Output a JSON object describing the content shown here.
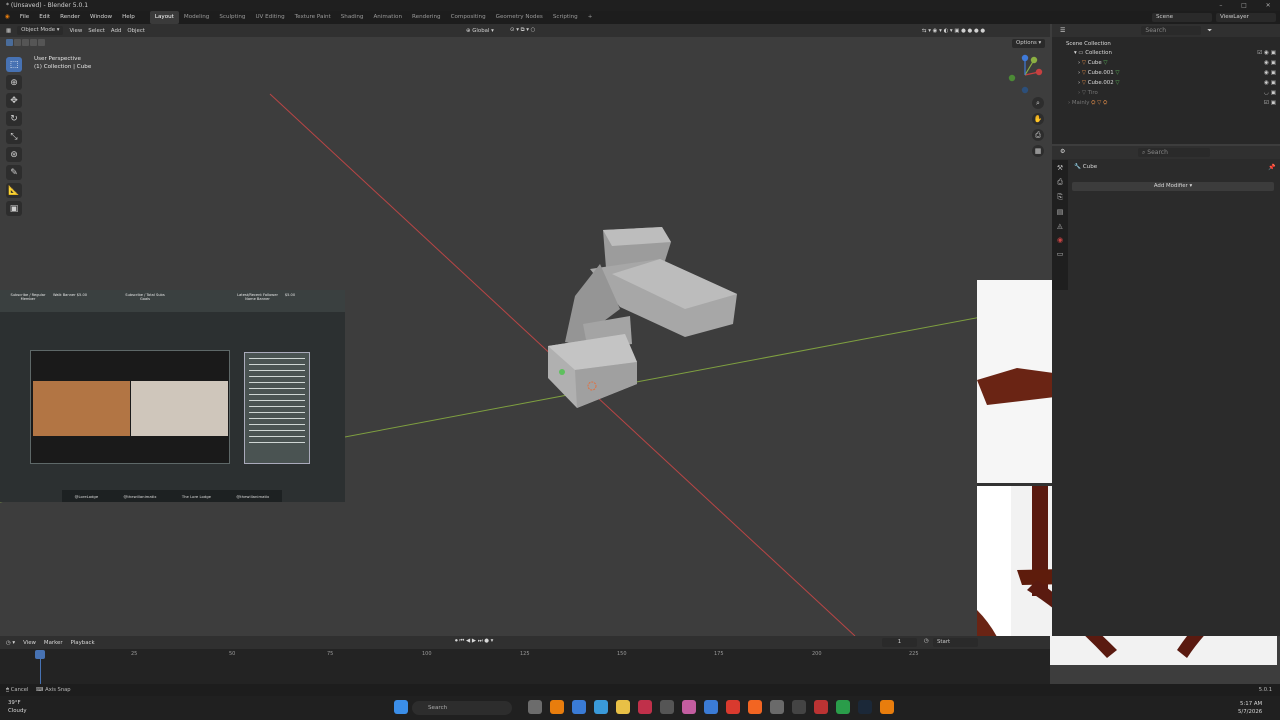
{
  "window": {
    "title": "* (Unsaved) - Blender 5.0.1"
  },
  "menu": {
    "items": [
      "File",
      "Edit",
      "Render",
      "Window",
      "Help"
    ],
    "workspaces": [
      "Layout",
      "Modeling",
      "Sculpting",
      "UV Editing",
      "Texture Paint",
      "Shading",
      "Animation",
      "Rendering",
      "Compositing",
      "Geometry Nodes",
      "Scripting"
    ],
    "active_workspace": "Layout",
    "add_tab": "+",
    "scene": "Scene",
    "view_layer": "ViewLayer"
  },
  "viewport": {
    "mode": "Object Mode",
    "menus": [
      "View",
      "Select",
      "Add",
      "Object"
    ],
    "orientation": "Global",
    "options": "Options",
    "info_line1": "User Perspective",
    "info_line2": "(1) Collection | Cube"
  },
  "outliner": {
    "search_placeholder": "Search",
    "scene_collection": "Scene Collection",
    "collection": "Collection",
    "objects": [
      "Cube",
      "Cube.001",
      "Cube.002",
      "Tiro",
      "Mainly"
    ]
  },
  "properties": {
    "search_placeholder": "Search",
    "object_name": "Cube",
    "add_modifier": "Add Modifier"
  },
  "timeline": {
    "menus": [
      "View",
      "Marker",
      "Playback"
    ],
    "current_frame": "1",
    "start_label": "Start",
    "ticks": [
      "25",
      "50",
      "75",
      "100",
      "125",
      "150",
      "175",
      "200",
      "225"
    ]
  },
  "status": {
    "cancel": "Cancel",
    "axis_snap": "Axis Snap",
    "version": "5.0.1"
  },
  "stream": {
    "labels": [
      "Subscribe / Regular Member",
      "Walk Banner $5.00",
      "Subscribe / Total Subs Goals",
      "Latest/Recent Follower Name Banner",
      "$5.00"
    ],
    "socials": [
      "@LoreLodge",
      "@thewillanimatix",
      "The Lore Lodge",
      "@thewillanimatix"
    ]
  },
  "taskbar": {
    "weather_temp": "39°F",
    "weather_desc": "Cloudy",
    "search_placeholder": "Search",
    "time": "5:17 AM",
    "date": "5/7/2026"
  },
  "colors": {
    "accent": "#4772b3",
    "x_axis": "#c74040",
    "y_axis": "#8bb042",
    "bg": "#3d3d3d"
  }
}
